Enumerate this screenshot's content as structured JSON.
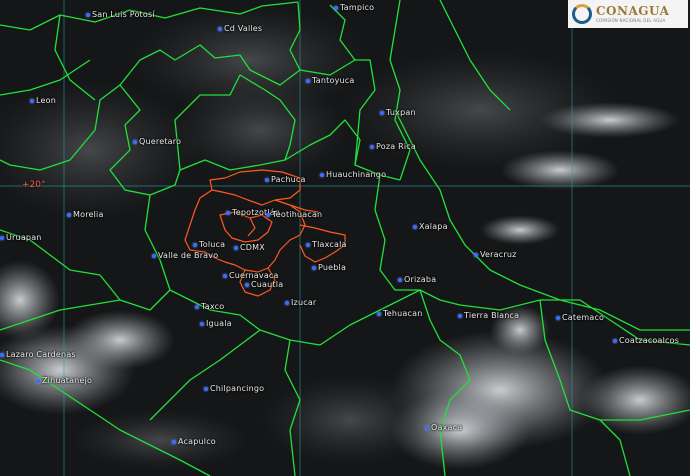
{
  "map": {
    "latitude_label": "+20°",
    "colors": {
      "state_border": "#22e03a",
      "capital_region": "#ff5a1e",
      "gridline": "#2aa0a8",
      "city_dot": "#3a6dff"
    },
    "logo": {
      "title": "CONAGUA",
      "subtitle": "COMISIÓN NACIONAL DEL AGUA"
    },
    "cities": [
      {
        "name": "San Luis Potosí"
      },
      {
        "name": "Cd Valles"
      },
      {
        "name": "Tampico"
      },
      {
        "name": "Leon"
      },
      {
        "name": "Tantoyuca"
      },
      {
        "name": "Tuxpan"
      },
      {
        "name": "Queretaro"
      },
      {
        "name": "Poza Rica"
      },
      {
        "name": "Pachuca"
      },
      {
        "name": "Huauchinango"
      },
      {
        "name": "Morelia"
      },
      {
        "name": "Tepotzotlán"
      },
      {
        "name": "Teotihuacan"
      },
      {
        "name": "Xalapa"
      },
      {
        "name": "Uruapan"
      },
      {
        "name": "Toluca"
      },
      {
        "name": "CDMX"
      },
      {
        "name": "Tlaxcala"
      },
      {
        "name": "Valle de Bravo"
      },
      {
        "name": "Veracruz"
      },
      {
        "name": "Puebla"
      },
      {
        "name": "Cuernavaca"
      },
      {
        "name": "Orizaba"
      },
      {
        "name": "Cuautla"
      },
      {
        "name": "Izucar"
      },
      {
        "name": "Taxco"
      },
      {
        "name": "Tehuacan"
      },
      {
        "name": "Tierra Blanca"
      },
      {
        "name": "Catemaco"
      },
      {
        "name": "Iguala"
      },
      {
        "name": "Coatzacoalcos"
      },
      {
        "name": "Lazaro Cardenas"
      },
      {
        "name": "Zihuatanejo"
      },
      {
        "name": "Chilpancingo"
      },
      {
        "name": "Oaxaca"
      },
      {
        "name": "Acapulco"
      }
    ]
  }
}
